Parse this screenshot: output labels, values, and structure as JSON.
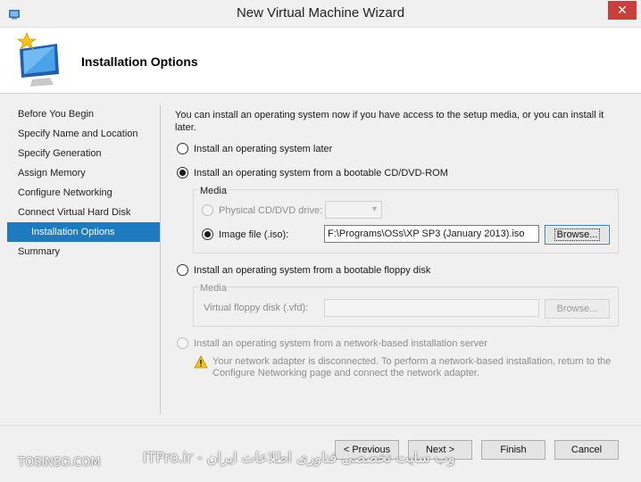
{
  "window": {
    "title": "New Virtual Machine Wizard",
    "close_glyph": "✕"
  },
  "header": {
    "page_title": "Installation Options"
  },
  "nav": {
    "items": [
      {
        "label": "Before You Begin"
      },
      {
        "label": "Specify Name and Location"
      },
      {
        "label": "Specify Generation"
      },
      {
        "label": "Assign Memory"
      },
      {
        "label": "Configure Networking"
      },
      {
        "label": "Connect Virtual Hard Disk"
      },
      {
        "label": "Installation Options",
        "active": true
      },
      {
        "label": "Summary"
      }
    ]
  },
  "content": {
    "intro": "You can install an operating system now if you have access to the setup media, or you can install it later.",
    "option_later": "Install an operating system later",
    "option_cd": "Install an operating system from a bootable CD/DVD-ROM",
    "cd_media_legend": "Media",
    "physical_drive_label": "Physical CD/DVD drive:",
    "image_file_label": "Image file (.iso):",
    "image_file_value": "F:\\Programs\\OSs\\XP SP3 (January 2013).iso",
    "browse_label": "Browse...",
    "option_floppy": "Install an operating system from a bootable floppy disk",
    "floppy_media_legend": "Media",
    "floppy_label": "Virtual floppy disk (.vfd):",
    "floppy_browse_label": "Browse...",
    "option_network": "Install an operating system from a network-based installation server",
    "network_warning": "Your network adapter is disconnected. To perform a network-based installation, return to the Configure Networking page and connect the network adapter."
  },
  "footer": {
    "previous_label": "< Previous",
    "next_label": "Next >",
    "finish_label": "Finish",
    "cancel_label": "Cancel"
  },
  "watermark": {
    "left": "TOSINSO.COM",
    "right": "ITPro.ir - وب سایت تخصصی فناوری اطلاعات ایران"
  },
  "colors": {
    "accent": "#1e7bbf",
    "close": "#c7403a"
  }
}
